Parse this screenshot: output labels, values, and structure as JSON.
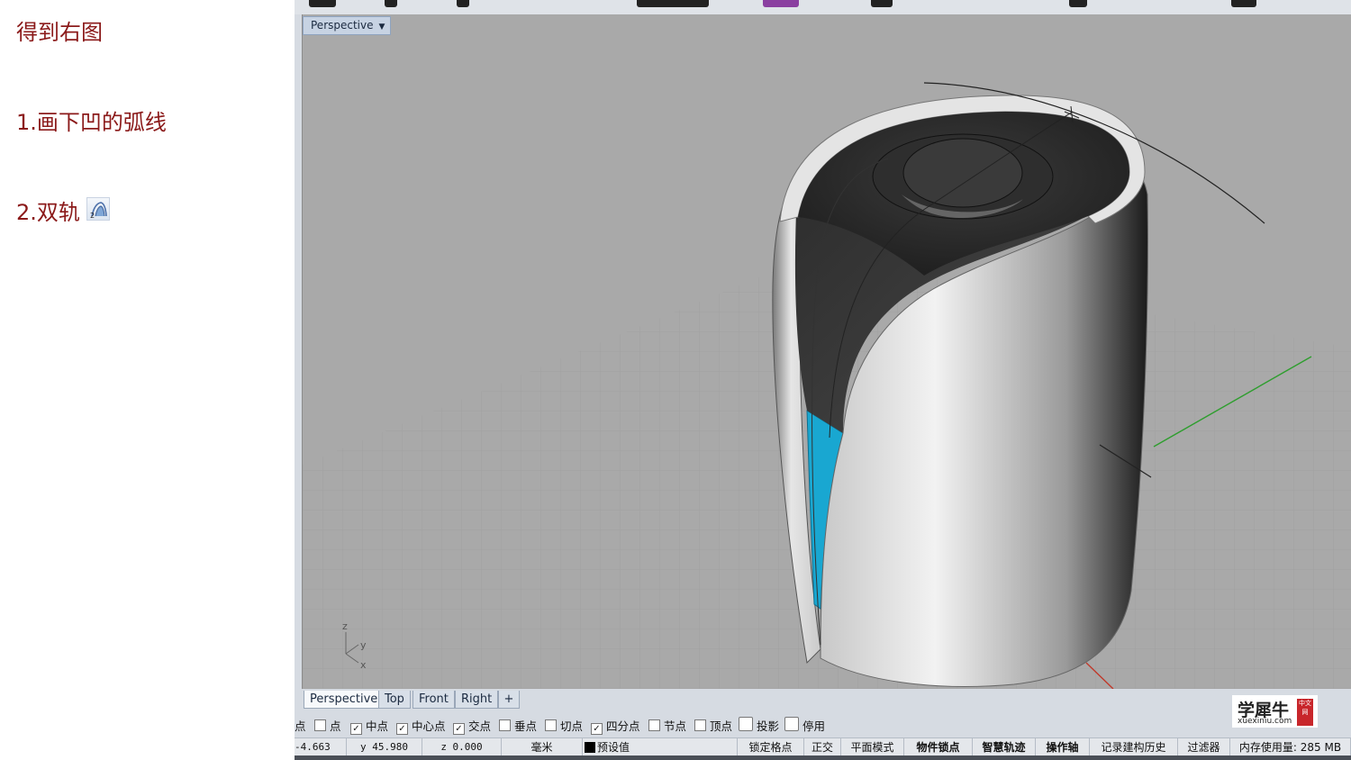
{
  "notes": {
    "line1": "得到右图",
    "line2": "1.画下凹的弧线",
    "line3": "2.双轨",
    "sweep_icon_digit": "2"
  },
  "viewport": {
    "label": "Perspective",
    "axis_z": "z",
    "axis_y": "y",
    "axis_x": "x"
  },
  "tabs": [
    {
      "label": "Perspective",
      "active": true
    },
    {
      "label": "Top"
    },
    {
      "label": "Front"
    },
    {
      "label": "Right"
    },
    {
      "label": "+"
    }
  ],
  "osnaps": [
    {
      "label": "点",
      "checked": false
    },
    {
      "label": "中点",
      "checked": true
    },
    {
      "label": "中心点",
      "checked": true
    },
    {
      "label": "交点",
      "checked": true
    },
    {
      "label": "垂点",
      "checked": false
    },
    {
      "label": "切点",
      "checked": false
    },
    {
      "label": "四分点",
      "checked": true
    },
    {
      "label": "节点",
      "checked": false
    },
    {
      "label": "顶点",
      "checked": false
    },
    {
      "label": "投影",
      "checked": false
    },
    {
      "label": "停用",
      "checked": false
    }
  ],
  "osnap_leading_fragment": "点",
  "status": {
    "x": "-4.663",
    "y": "y 45.980",
    "z": "z 0.000",
    "unit": "毫米",
    "layer": "预设值",
    "layer_color": "#000000",
    "grid_snap": "锁定格点",
    "ortho": "正交",
    "planar": "平面模式",
    "osnap": "物件锁点",
    "smart_track": "智慧轨迹",
    "gumball": "操作轴",
    "history": "记录建构历史",
    "filter": "过滤器",
    "memory": "内存使用量: 285 MB"
  },
  "logo": {
    "name": "学犀牛",
    "url_text": "xuexiniu.com",
    "seal": "中文网"
  },
  "colors": {
    "note_text": "#8b1a1a",
    "viewport_bg": "#a9a9a9",
    "highlight_surface": "#19a7d1",
    "x_axis": "#c0392b",
    "y_axis": "#2e9e2e"
  }
}
